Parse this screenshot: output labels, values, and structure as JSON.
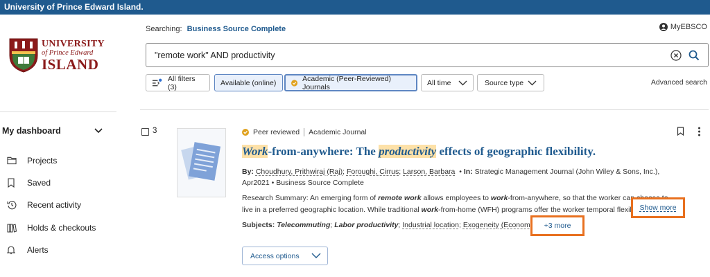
{
  "topbar": {
    "title": "University of Prince Edward Island."
  },
  "logo": {
    "line1": "UNIVERSITY",
    "line2": "of Prince Edward",
    "line3": "ISLAND"
  },
  "sidebar": {
    "dashboard_label": "My dashboard",
    "items": [
      {
        "label": "Projects",
        "icon": "folder-icon"
      },
      {
        "label": "Saved",
        "icon": "bookmark-icon"
      },
      {
        "label": "Recent activity",
        "icon": "history-icon"
      },
      {
        "label": "Holds & checkouts",
        "icon": "books-icon"
      },
      {
        "label": "Alerts",
        "icon": "bell-icon"
      }
    ]
  },
  "header": {
    "searching_label": "Searching:",
    "database": "Business Source Complete",
    "account_label": "MyEBSCO"
  },
  "search": {
    "query": "\"remote work\" AND productivity"
  },
  "filters": {
    "all_filters": "All filters (3)",
    "available_online": "Available (online)",
    "peer_reviewed": "Academic (Peer-Reviewed) Journals",
    "time": "All time",
    "source_type": "Source type",
    "advanced": "Advanced search"
  },
  "result": {
    "number": "3",
    "peer_reviewed": "Peer reviewed",
    "doc_type": "Academic Journal",
    "title_parts": [
      "Work",
      "-from-anywhere: The ",
      "productivity",
      " effects of geographic flexibility."
    ],
    "by_label": "By:",
    "authors": [
      "Choudhury, Prithwiraj (Raj)",
      "Foroughi, Cirrus",
      "Larson, Barbara"
    ],
    "in_label": "In:",
    "journal": "Strategic Management Journal (John Wiley & Sons, Inc.),",
    "date": "Apr2021",
    "source": "Business Source Complete",
    "summary_label": "Research Summary:",
    "summary_parts": [
      " An emerging form of ",
      "remote work",
      " allows employees to ",
      "work",
      "-from-anywhere, so that the worker can choose to live in a preferred geographic location. While traditional ",
      "work",
      "-from-home (WFH) programs offer the worker temporal flexibility..."
    ],
    "show_more": "Show more",
    "subjects_label": "Subjects:",
    "subjects_bold": [
      "Telecommuting",
      "Labor productivity"
    ],
    "subjects_plain": [
      "Industrial location",
      "Exogeneity (Econometrics)"
    ],
    "plus_more": "+3 more",
    "access_options": "Access options"
  },
  "colors": {
    "topbar": "#1f5a8e",
    "link": "#1f5a8e",
    "highlight": "#fde1a8",
    "callout": "#e8701f",
    "logo": "#8b1a1a"
  }
}
